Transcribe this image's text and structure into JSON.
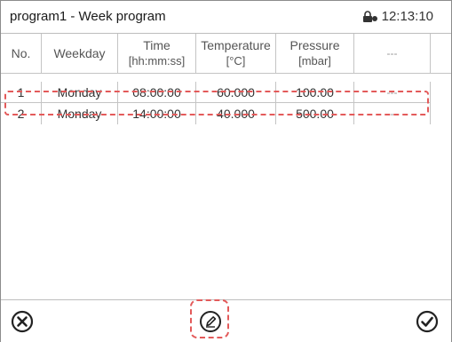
{
  "window": {
    "title": "program1 - Week program",
    "time": "12:13:10",
    "status_icon": "lock-icon"
  },
  "table": {
    "headers": [
      {
        "label": "No.",
        "unit": ""
      },
      {
        "label": "Weekday",
        "unit": ""
      },
      {
        "label": "Time",
        "unit": "[hh:mm:ss]"
      },
      {
        "label": "Temperature",
        "unit": "[°C]"
      },
      {
        "label": "Pressure",
        "unit": "[mbar]"
      },
      {
        "label": "---",
        "unit": ""
      }
    ],
    "rows": [
      {
        "no": "1",
        "weekday": "Monday",
        "time": "08:00:00",
        "temperature": "60.000",
        "pressure": "100.00",
        "extra": "---"
      },
      {
        "no": "2",
        "weekday": "Monday",
        "time": "14:00:00",
        "temperature": "40.000",
        "pressure": "500.00",
        "extra": "---"
      }
    ]
  },
  "toolbar": {
    "cancel_icon": "cancel-icon",
    "edit_icon": "edit-icon",
    "confirm_icon": "confirm-icon"
  },
  "colors": {
    "highlight": "#e35a5a",
    "border": "#bdbdbd",
    "text": "#333333"
  }
}
